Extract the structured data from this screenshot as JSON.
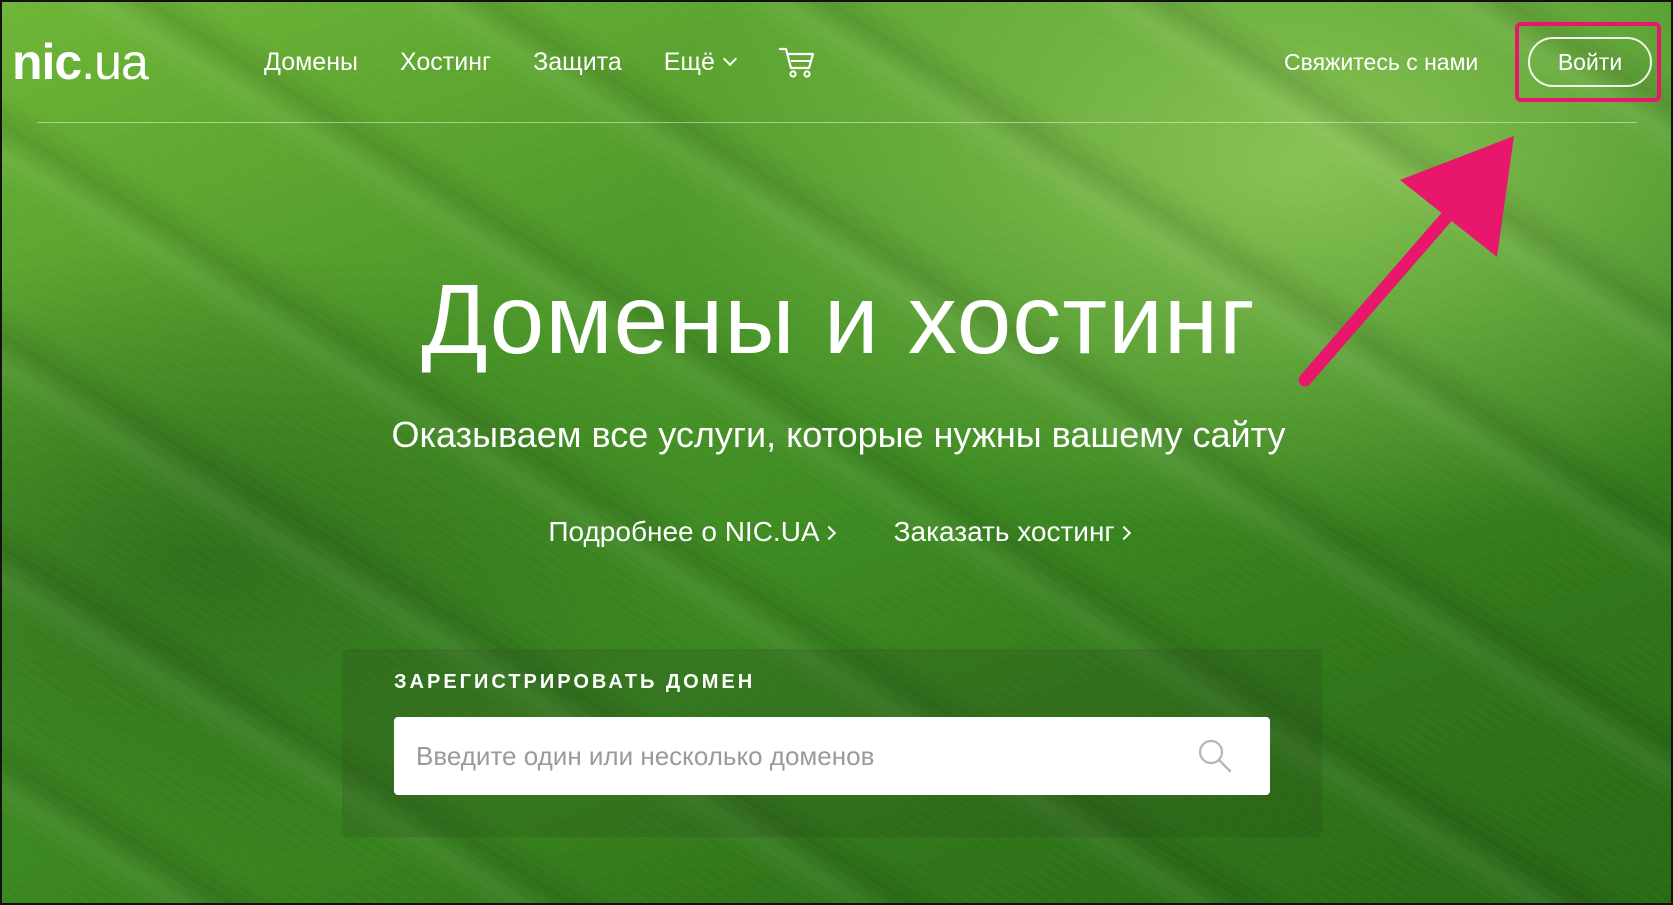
{
  "header": {
    "logo_bold": "nic",
    "logo_light": ".ua",
    "nav": [
      {
        "label": "Домены"
      },
      {
        "label": "Хостинг"
      },
      {
        "label": "Защита"
      },
      {
        "label": "Ещё"
      }
    ],
    "cart_icon": "cart-icon",
    "contact_label": "Свяжитесь с нами",
    "login_label": "Войти"
  },
  "annotation": {
    "color": "#e8176c",
    "highlight": "login-button",
    "arrow_icon": "arrow-icon"
  },
  "hero": {
    "title": "Домены и хостинг",
    "subtitle": "Оказываем все услуги, которые нужны вашему сайту",
    "links": [
      {
        "label": "Подробнее о NIC.UA"
      },
      {
        "label": "Заказать хостинг"
      }
    ]
  },
  "domain_search": {
    "label": "ЗАРЕГИСТРИРОВАТЬ ДОМЕН",
    "placeholder": "Введите один или несколько доменов",
    "value": "",
    "search_icon": "search-icon"
  }
}
